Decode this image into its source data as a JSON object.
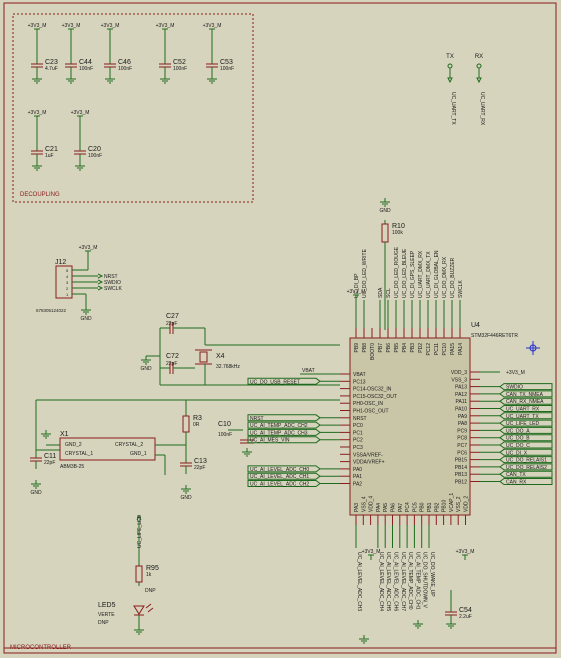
{
  "frame": {
    "title": "MICROCONTROLLER"
  },
  "decoupling": {
    "title": "DECOUPLING",
    "power": "+3V3_M",
    "caps": [
      {
        "ref": "C23",
        "value": "4.7uF"
      },
      {
        "ref": "C44",
        "value": "100nF"
      },
      {
        "ref": "C46",
        "value": "100nF"
      },
      {
        "ref": "C52",
        "value": "100nF"
      },
      {
        "ref": "C53",
        "value": "100nF"
      },
      {
        "ref": "C21",
        "value": "1uF"
      },
      {
        "ref": "C20",
        "value": "100nF"
      }
    ]
  },
  "uart": {
    "tx": "TX",
    "rx": "RX",
    "tx_net": "UC_UART_TX",
    "rx_net": "UC_UART_RX"
  },
  "j12": {
    "ref": "J12",
    "part": "679305124022",
    "power": "+3V3_M",
    "gnd": "GND",
    "pins": [
      "5",
      "4",
      "3",
      "2",
      "1"
    ],
    "nets": [
      "NRST",
      "SWDIO",
      "SWCLK"
    ]
  },
  "r10": {
    "ref": "R10",
    "value": "100k",
    "gnd": "GND"
  },
  "c27": {
    "ref": "C27",
    "value": "22pF"
  },
  "c72": {
    "ref": "C72",
    "value": "22pF"
  },
  "x4": {
    "ref": "X4",
    "value": "32.768kHz"
  },
  "x1": {
    "ref": "X1",
    "part": "ABM3B-25",
    "pins": [
      "GND_2",
      "CRYSTAL_1",
      "CRYSTAL_2",
      "GND_1"
    ]
  },
  "c11": {
    "ref": "C11",
    "value": "22pF"
  },
  "r3": {
    "ref": "R3",
    "value": "0R"
  },
  "c10": {
    "ref": "C10",
    "value": "100nF"
  },
  "c13": {
    "ref": "C13",
    "value": "22pF"
  },
  "c54": {
    "ref": "C54",
    "value": "2.2uF"
  },
  "r95": {
    "ref": "R95",
    "value": "1k",
    "note": "DNP"
  },
  "led5": {
    "ref": "LED5",
    "value": "VERTE",
    "note": "DNP",
    "net": "UC_LIFE_LED"
  },
  "gnd": "GND",
  "mcu": {
    "ref": "U4",
    "part": "STM32F446RET6TR",
    "left_pins": [
      "VBAT",
      "PC13",
      "PC14-OSC32_IN",
      "PC15-OSC32_OUT",
      "PH0-OSC_IN",
      "PH1-OSC_OUT",
      "NRST",
      "PC0",
      "PC1",
      "PC2",
      "PC3",
      "VSSA/VREF-",
      "VDDA/VREF+",
      "PA0",
      "PA1",
      "PA2"
    ],
    "right_pins": [
      "VDD_3",
      "VSS_3",
      "PA13",
      "PA12",
      "PA11",
      "PA10",
      "PA9",
      "PA8",
      "PC9",
      "PC8",
      "PC7",
      "PC6",
      "PB15",
      "PB14",
      "PB13",
      "PB12"
    ],
    "top_pins": [
      "PB9",
      "PB8",
      "BOOT0",
      "PB7",
      "PB6",
      "PB5",
      "PB4",
      "PB3",
      "PD2",
      "PC12",
      "PC11",
      "PC10",
      "PA15",
      "PA14"
    ],
    "bottom_pins": [
      "PA3",
      "VSS_4",
      "VDD_4",
      "PA4",
      "PA5",
      "PA6",
      "PA7",
      "PC4",
      "PC5",
      "PB0",
      "PB1",
      "PB2",
      "PB10",
      "VCAP_1",
      "VSS_2",
      "VDD_2"
    ],
    "left_nets": [
      "",
      "UC_DO_USB_RESET",
      "",
      "",
      "",
      "",
      "NRST",
      "UC_AI_TEMP_ADC_CH2",
      "UC_AI_TEMP_ADC_CH3",
      "UC_AI_MES_VIN",
      "",
      "",
      "",
      "UC_AI_LEVEL_ADC_CH0",
      "UC_AI_LEVEL_ADC_CH1",
      "UC_AI_LEVEL_ADC_CH2"
    ],
    "right_nets": [
      "+3V3_M",
      "",
      "SWDIO",
      "CAN_TX_NMEA",
      "CAN_RX_NMEA",
      "UC_UART_RX",
      "UC_UART_TX",
      "UC_LIFE_LED",
      "UC_DO_A",
      "UC_DO_B",
      "UC_DO_C",
      "UC_DI_X",
      "UC_DO_RELAIS1",
      "UC_DO_RELAIS2",
      "CAN_TX",
      "CAN_RX"
    ],
    "top_nets": [
      "UC_DI_BP",
      "UC_DO_LED_WRITE",
      "",
      "SDA",
      "SCL",
      "UC_DO_LED_ROUGE",
      "UC_DO_LED_BLEUE",
      "UC_DI_GPS_SLEEP",
      "UC_UART_DMX_RX",
      "UC_UART_DMX_TX",
      "UC_DI_GLOBAL_EN",
      "UC_DO_DMX_RX",
      "UC_DO_BUZZER",
      "SWCLK"
    ],
    "bottom_nets": [
      "UC_AI_LEVEL_ADC_CH3",
      "",
      "",
      "UC_AI_LEVEL_ADC_CH4",
      "UC_AI_LEVEL_ADC_CH5",
      "UC_AI_LEVEL_ADC_CH6",
      "UC_AI_LEVEL_ADC_CH7",
      "UC_AI_TEMP_ADC_CH0",
      "UC_AI_TEMP_ADC_CH1",
      "UC_DO_SHUTDOWN_V",
      "UC_DO_WAKE_UP",
      "",
      "",
      "",
      "",
      ""
    ],
    "power_label": "+3V3_M"
  }
}
